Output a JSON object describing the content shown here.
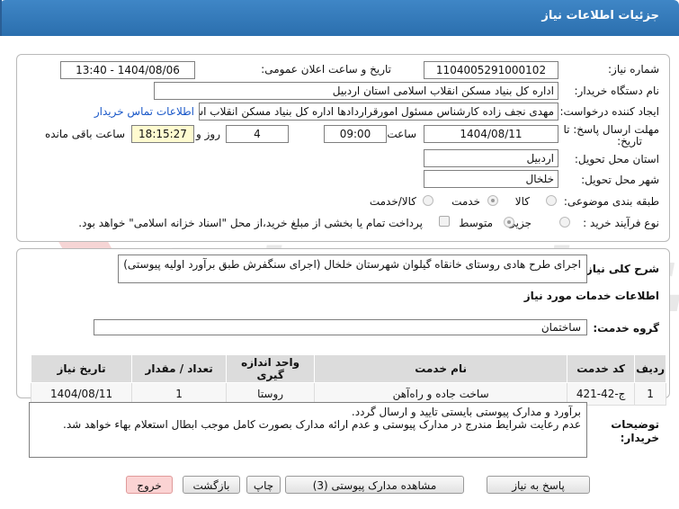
{
  "header": {
    "title": "جزئیات اطلاعات نیاز"
  },
  "fields": {
    "need_number_label": "شماره نیاز:",
    "need_number": "1104005291000102",
    "announce_label": "تاریخ و ساعت اعلان عمومی:",
    "announce_value": "1404/08/06 - 13:40",
    "buyer_org_label": "نام دستگاه خریدار:",
    "buyer_org": "اداره کل بنیاد مسکن انقلاب اسلامی استان اردبیل",
    "creator_label": "ایجاد کننده درخواست:",
    "creator": "مهدی نجف زاده کارشناس مسئول امورقراردادها اداره کل بنیاد مسکن انقلاب اس",
    "contact_link": "اطلاعات تماس خریدار",
    "deadline_label_1": "مهلت ارسال پاسخ: تا",
    "deadline_label_2": "تاریخ:",
    "deadline_date": "1404/08/11",
    "time_label": "ساعت",
    "deadline_time": "09:00",
    "days_value": "4",
    "days_label": "روز و",
    "remaining_time": "18:15:27",
    "remaining_label": "ساعت باقی مانده",
    "province_label": "استان محل تحویل:",
    "province": "اردبیل",
    "city_label": "شهر محل تحویل:",
    "city": "خلخال",
    "category_label": "طبقه بندی موضوعی:",
    "category_options": [
      "کالا",
      "خدمت",
      "کالا/خدمت"
    ],
    "process_label": "نوع فرآیند خرید :",
    "process_options": [
      "جزیی",
      "متوسط"
    ],
    "payment_note": "پرداخت تمام یا بخشی از مبلغ خرید،از محل \"اسناد خزانه اسلامی\" خواهد بود."
  },
  "description": {
    "label": "شرح کلی نیاز:",
    "text": "اجرای طرح هادی روستای خانقاه گیلوان شهرستان خلخال (اجرای سنگفرش طبق برآورد اولیه پیوستی)"
  },
  "services": {
    "section_title": "اطلاعات خدمات مورد نیاز",
    "group_label": "گروه خدمت:",
    "group_value": "ساختمان",
    "headers": [
      "ردیف",
      "کد خدمت",
      "نام خدمت",
      "واحد اندازه گیری",
      "تعداد / مقدار",
      "تاریخ نیاز"
    ],
    "rows": [
      [
        "1",
        "ج-42-421",
        "ساخت جاده و راه‌آهن",
        "روستا",
        "1",
        "1404/08/11"
      ]
    ]
  },
  "buyer_notes": {
    "label_1": "توضیحات",
    "label_2": "خریدار:",
    "line1": "برآورد و مدارک پیوستی بایستی تایید و ارسال گردد.",
    "line2": "عدم رعایت شرایط مندرج در مدارک پیوستی و عدم ارائه مدارک بصورت کامل موجب ابطال استعلام بهاء خواهد شد."
  },
  "buttons": {
    "reply": "پاسخ به نیاز",
    "attachments": "مشاهده مدارک پیوستی (3)",
    "print": "چاپ",
    "back": "بازگشت",
    "exit": "خروج"
  },
  "watermark": "AriaTender.net"
}
